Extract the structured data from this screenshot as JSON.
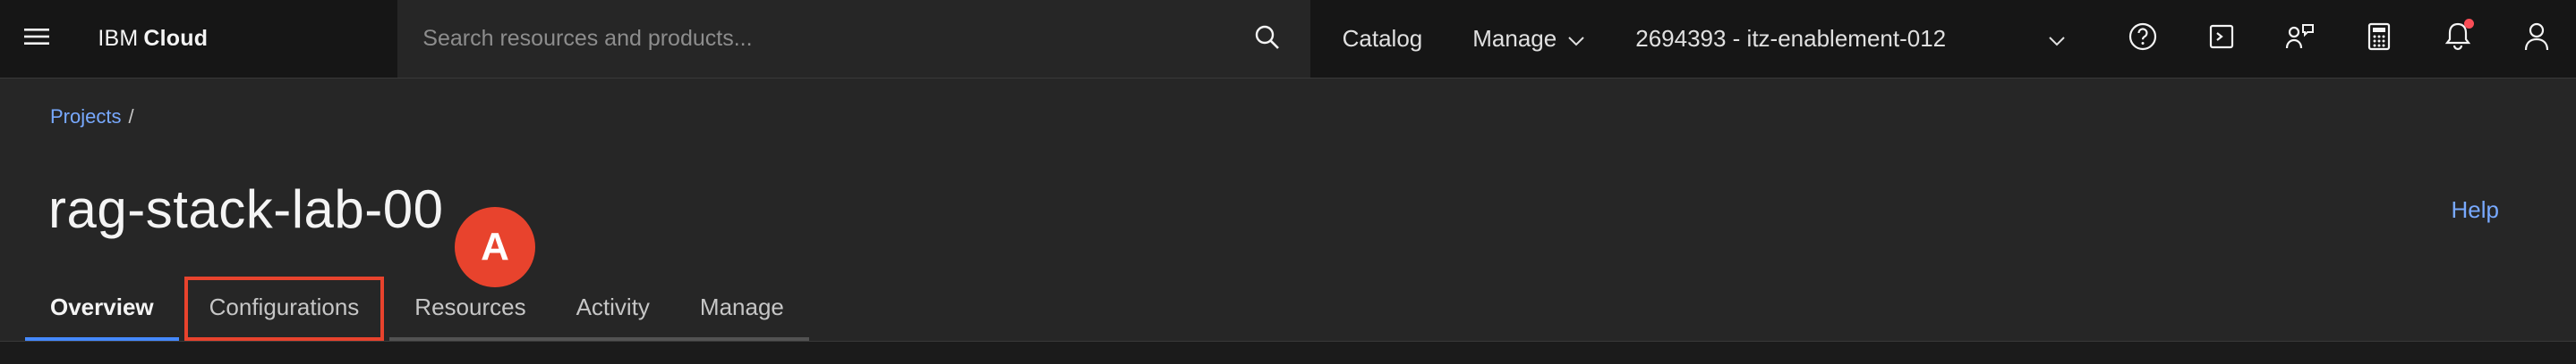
{
  "header": {
    "brand_prefix": "IBM",
    "brand_name": "Cloud",
    "search_placeholder": "Search resources and products...",
    "catalog_label": "Catalog",
    "manage_label": "Manage",
    "account_label": "2694393 - itz-enablement-012",
    "icons": [
      "menu-icon",
      "search-icon",
      "help-icon",
      "cost-estimator-icon",
      "switcher-icon",
      "calculator-icon",
      "notification-icon",
      "user-icon"
    ]
  },
  "breadcrumb": {
    "root": "Projects",
    "separator": "/"
  },
  "page": {
    "title": "rag-stack-lab-00",
    "help_label": "Help"
  },
  "annotation": {
    "marker_label": "A"
  },
  "tabs": [
    {
      "label": "Overview",
      "active": true
    },
    {
      "label": "Configurations",
      "active": false
    },
    {
      "label": "Resources",
      "active": false
    },
    {
      "label": "Activity",
      "active": false
    },
    {
      "label": "Manage",
      "active": false
    }
  ],
  "colors": {
    "accent": "#4589ff",
    "link": "#78a9ff",
    "marker": "#e8432d",
    "notification": "#fa4d56"
  }
}
